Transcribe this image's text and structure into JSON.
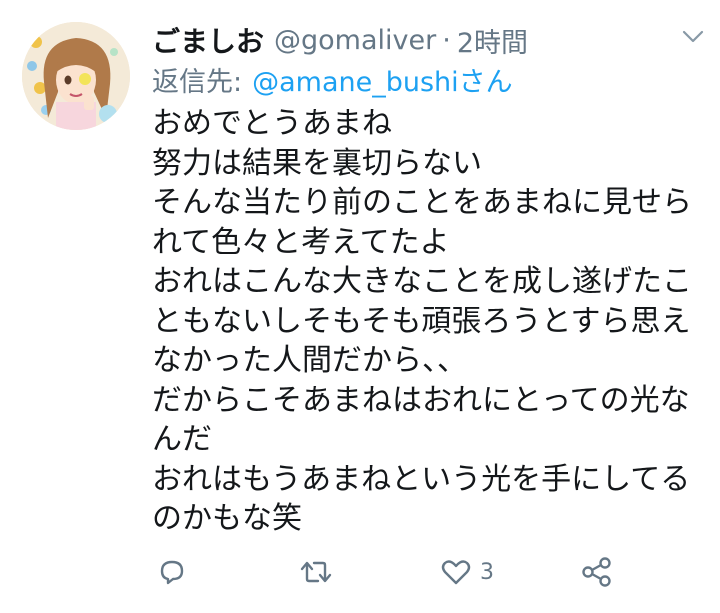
{
  "user": {
    "display_name": "ごましお",
    "handle": "@gomaliver",
    "separator": "·",
    "time": "2時間"
  },
  "reply": {
    "prefix": "返信先:",
    "to": "@amane_bushiさん"
  },
  "body_lines": [
    "おめでとうあまね",
    "努力は結果を裏切らない",
    "そんな当たり前のことをあまねに見せら",
    "れて色々と考えてたよ",
    "おれはこんな大きなことを成し遂げたこ",
    "ともないしそもそも頑張ろうとすら思え",
    "なかった人間だから、、",
    "だからこそあまねはおれにとっての光な",
    "んだ",
    "おれはもうあまねという光を手にしてる",
    "のかもな笑"
  ],
  "actions": {
    "like_count": "3"
  },
  "icons": {
    "menu": "chevron-down-icon",
    "reply": "reply-icon",
    "retweet": "retweet-icon",
    "like": "heart-icon",
    "share": "share-icon"
  },
  "colors": {
    "text": "#14171a",
    "secondary": "#657786",
    "link": "#1da1f2",
    "icon": "#657786"
  }
}
